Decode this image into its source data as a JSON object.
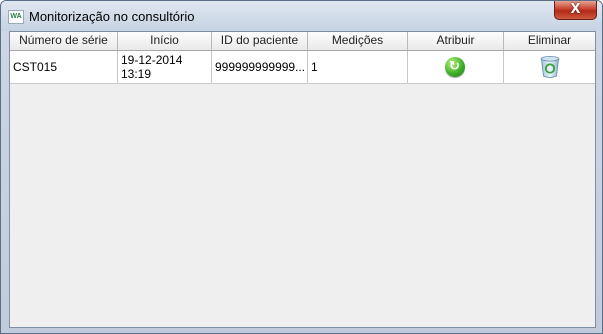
{
  "window": {
    "title": "Monitorização no consultório",
    "icon_text": "WA",
    "close_label": "X"
  },
  "table": {
    "columns": [
      "Número de série",
      "Início",
      "ID do paciente",
      "Medições",
      "Atribuir",
      "Eliminar"
    ],
    "rows": [
      {
        "serial": "CST015",
        "start_date": "19-12-2014",
        "start_time": "13:19",
        "patient_id": "999999999999...",
        "measurements": "1",
        "assign_icon": "refresh-arrow-icon",
        "delete_icon": "recycle-bin-icon"
      }
    ]
  },
  "colors": {
    "assign_icon": "#3fb02a",
    "close_button": "#c8412d"
  }
}
